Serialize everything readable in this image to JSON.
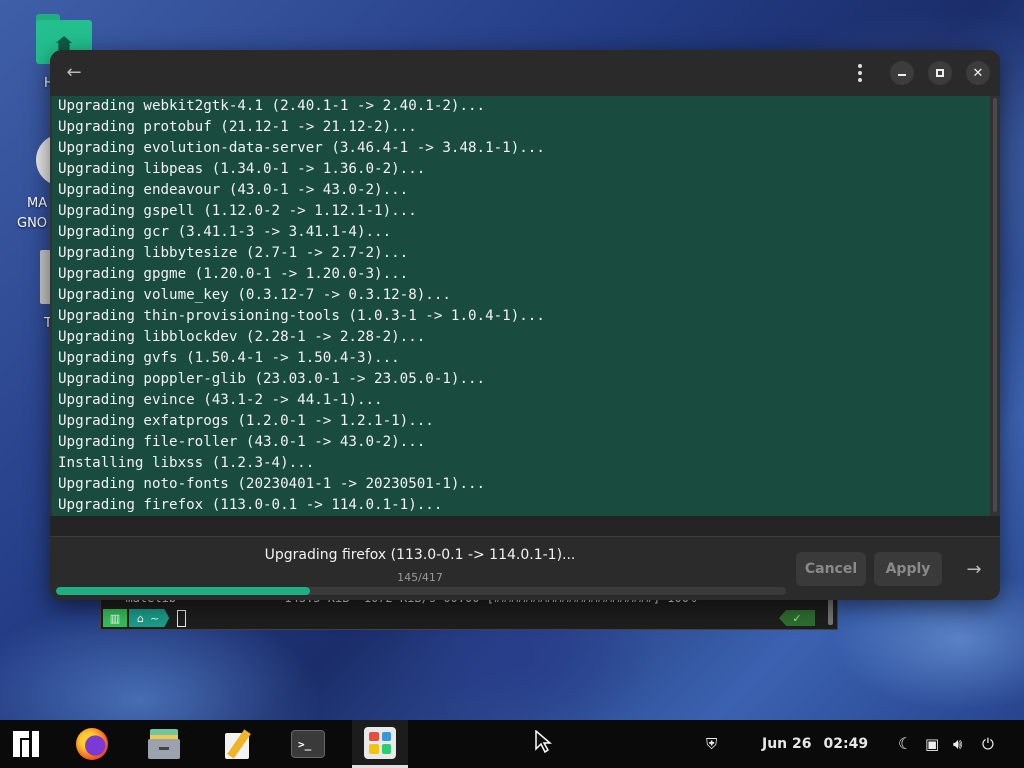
{
  "desktop": {
    "icons": [
      {
        "label": "H",
        "icon": "home-folder-icon"
      },
      {
        "label": "MA",
        "icon": "manjaro-disc-icon"
      },
      {
        "label": "GNO",
        "icon": "manjaro-disc-icon"
      },
      {
        "label": "T",
        "icon": "trash-icon"
      }
    ]
  },
  "terminal": {
    "partial_line": "  matelib               143.5 KiB  1072 KiB/s 00:00 [######################] 100%",
    "prompt_home": "~",
    "status_ok": "✓"
  },
  "dialog": {
    "log_lines": [
      "Upgrading webkit2gtk-4.1 (2.40.1-1 -> 2.40.1-2)...",
      "Upgrading protobuf (21.12-1 -> 21.12-2)...",
      "Upgrading evolution-data-server (3.46.4-1 -> 3.48.1-1)...",
      "Upgrading libpeas (1.34.0-1 -> 1.36.0-2)...",
      "Upgrading endeavour (43.0-1 -> 43.0-2)...",
      "Upgrading gspell (1.12.0-2 -> 1.12.1-1)...",
      "Upgrading gcr (3.41.1-3 -> 3.41.1-4)...",
      "Upgrading libbytesize (2.7-1 -> 2.7-2)...",
      "Upgrading gpgme (1.20.0-1 -> 1.20.0-3)...",
      "Upgrading volume_key (0.3.12-7 -> 0.3.12-8)...",
      "Upgrading thin-provisioning-tools (1.0.3-1 -> 1.0.4-1)...",
      "Upgrading libblockdev (2.28-1 -> 2.28-2)...",
      "Upgrading gvfs (1.50.4-1 -> 1.50.4-3)...",
      "Upgrading poppler-glib (23.03.0-1 -> 23.05.0-1)...",
      "Upgrading evince (43.1-2 -> 44.1-1)...",
      "Upgrading exfatprogs (1.2.0-1 -> 1.2.1-1)...",
      "Upgrading file-roller (43.0-1 -> 43.0-2)...",
      "Installing libxss (1.2.3-4)...",
      "Upgrading noto-fonts (20230401-1 -> 20230501-1)...",
      "Upgrading firefox (113.0-0.1 -> 114.0.1-1)..."
    ],
    "status_text": "Upgrading firefox (113.0-0.1 -> 114.0.1-1)...",
    "progress_count": "145/417",
    "progress_fraction": 0.348,
    "cancel_label": "Cancel",
    "apply_label": "Apply",
    "accent_color": "#1fae84"
  },
  "taskbar": {
    "apps": [
      {
        "name": "manjaro-menu-icon"
      },
      {
        "name": "firefox-icon"
      },
      {
        "name": "files-icon"
      },
      {
        "name": "text-editor-icon"
      },
      {
        "name": "terminal-icon"
      },
      {
        "name": "software-manager-icon",
        "active": true
      }
    ],
    "clock_date": "Jun 26",
    "clock_time": "02:49",
    "tray_icons": [
      "shield-icon",
      "night-mode-icon",
      "network-icon",
      "volume-icon",
      "power-icon"
    ]
  }
}
